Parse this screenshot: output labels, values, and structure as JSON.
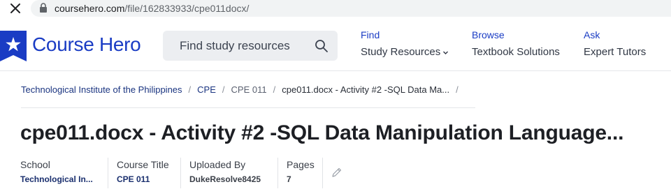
{
  "browser": {
    "url_host": "coursehero.com",
    "url_path": "/file/162833933/cpe011docx/"
  },
  "header": {
    "logo_text": "Course Hero",
    "search_placeholder": "Find study resources",
    "nav": [
      {
        "top": "Find",
        "bottom": "Study Resources"
      },
      {
        "top": "Browse",
        "bottom": "Textbook Solutions"
      },
      {
        "top": "Ask",
        "bottom": "Expert Tutors"
      }
    ]
  },
  "breadcrumb": {
    "items": [
      "Technological Institute of the Philippines",
      "CPE",
      "CPE 011",
      "cpe011.docx - Activity #2 -SQL Data Ma..."
    ],
    "separator": "/"
  },
  "document": {
    "title": "cpe011.docx - Activity #2 -SQL Data Manipulation Language..."
  },
  "meta": {
    "school_label": "School",
    "school_value": "Technological In...",
    "course_label": "Course Title",
    "course_value": "CPE 011",
    "uploaded_label": "Uploaded By",
    "uploaded_value": "DukeResolve8425",
    "pages_label": "Pages",
    "pages_value": "7"
  },
  "colors": {
    "brand_blue": "#1a3cc4",
    "link_navy": "#1a2f6e",
    "search_bg": "#eceef1"
  }
}
